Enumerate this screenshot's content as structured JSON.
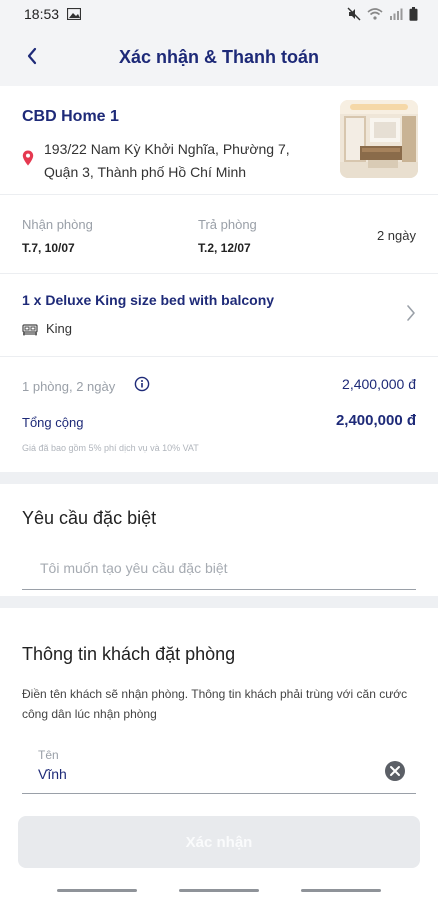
{
  "status_bar": {
    "time": "18:53"
  },
  "header": {
    "title": "Xác nhận & Thanh toán"
  },
  "hotel": {
    "name": "CBD Home 1",
    "address": "193/22 Nam Kỳ Khởi Nghĩa, Phường 7, Quận 3, Thành phố Hồ Chí Minh"
  },
  "stay": {
    "checkin_label": "Nhận phòng",
    "checkin_date": "T.7, 10/07",
    "checkout_label": "Trả phòng",
    "checkout_date": "T.2, 12/07",
    "nights": "2 ngày"
  },
  "room": {
    "title": "1 x Deluxe King size bed with balcony",
    "bed": "King"
  },
  "price": {
    "line_label": "1 phòng, 2 ngày",
    "line_value": "2,400,000 đ",
    "total_label": "Tổng cộng",
    "total_value": "2,400,000 đ",
    "tax_note": "Giá đã bao gồm 5% phí dịch vụ và 10% VAT"
  },
  "special_request": {
    "title": "Yêu cầu đặc biệt",
    "placeholder": "Tôi muốn tạo yêu cầu đặc biệt"
  },
  "guest": {
    "title": "Thông tin khách đặt phòng",
    "description": "Điền tên khách sẽ nhận phòng. Thông tin khách phải trùng với căn cước công dân lúc nhận phòng",
    "name_label": "Tên",
    "name_value": "Vĩnh"
  },
  "actions": {
    "confirm_label": "Xác nhận"
  },
  "colors": {
    "brand": "#1e2a78",
    "pin": "#e53950",
    "muted": "#9aa0a8",
    "disabled_button": "#e8eaed"
  }
}
